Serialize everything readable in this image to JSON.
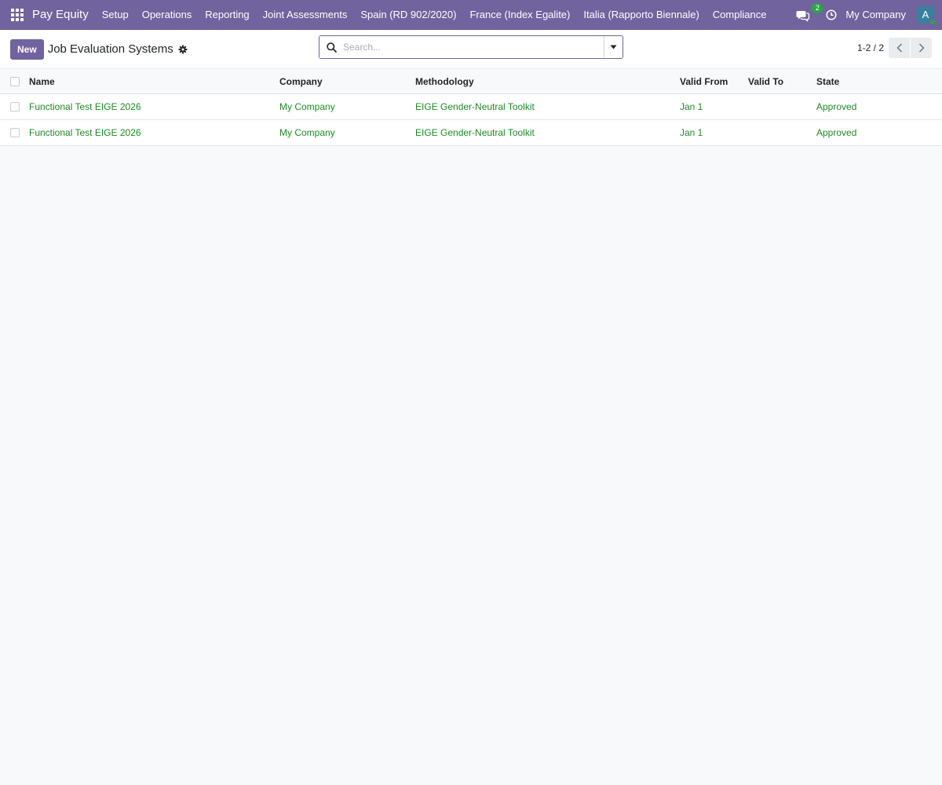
{
  "navbar": {
    "brand": "Pay Equity",
    "menu": [
      "Setup",
      "Operations",
      "Reporting",
      "Joint Assessments",
      "Spain (RD 902/2020)",
      "France (Index Egalite)",
      "Italia (Rapporto Biennale)",
      "Compliance"
    ],
    "messages_count": "2",
    "company": "My Company",
    "avatar_letter": "A"
  },
  "control": {
    "new_label": "New",
    "title": "Job Evaluation Systems",
    "search_placeholder": "Search...",
    "pager": "1-2 / 2"
  },
  "table": {
    "headers": {
      "name": "Name",
      "company": "Company",
      "methodology": "Methodology",
      "valid_from": "Valid From",
      "valid_to": "Valid To",
      "state": "State"
    },
    "rows": [
      {
        "name": "Functional Test EIGE 2026",
        "company": "My Company",
        "methodology": "EIGE Gender-Neutral Toolkit",
        "valid_from": "Jan 1",
        "valid_to": "",
        "state": "Approved"
      },
      {
        "name": "Functional Test EIGE 2026",
        "company": "My Company",
        "methodology": "EIGE Gender-Neutral Toolkit",
        "valid_from": "Jan 1",
        "valid_to": "",
        "state": "Approved"
      }
    ]
  },
  "colors": {
    "primary": "#71639e",
    "link_green": "#1d8a23",
    "badge_green": "#28a745"
  }
}
